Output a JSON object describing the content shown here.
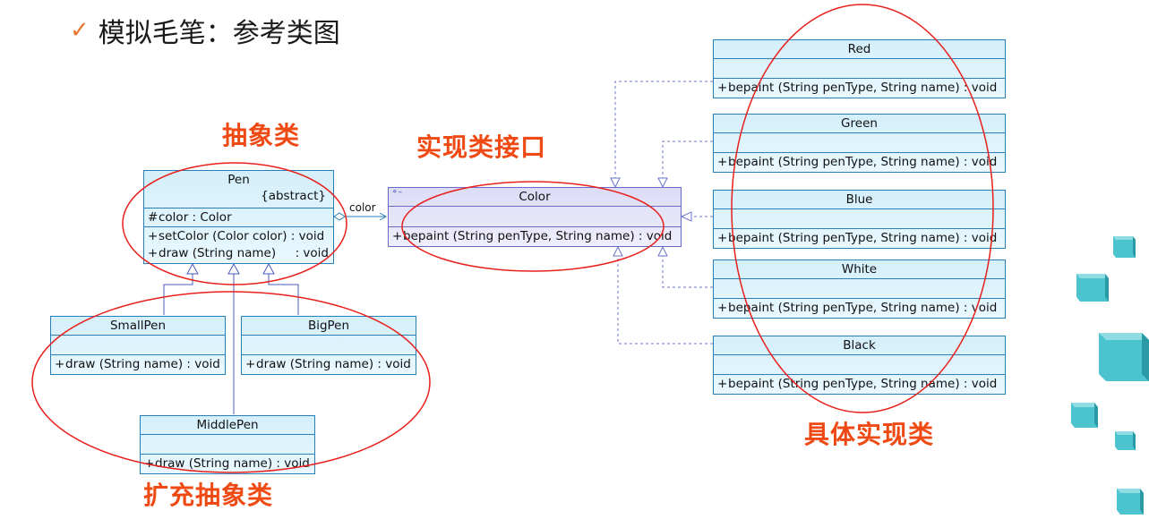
{
  "title": {
    "check_icon": "✓",
    "text": "模拟毛笔：参考类图"
  },
  "labels": {
    "abstract": "抽象类",
    "impl_interface": "实现类接口",
    "refined_abstract": "扩充抽象类",
    "concrete_impl": "具体实现类"
  },
  "association_label": "color",
  "pen": {
    "name": "Pen",
    "stereotype": "{abstract}",
    "attr_vis": "#",
    "attr": "color  : Color",
    "op1_vis": "+",
    "op1": "setColor (Color color) : void",
    "op2_vis": "+",
    "op2": "draw (String name)     : void"
  },
  "small_pen": {
    "name": "SmallPen",
    "op_vis": "+",
    "op": "draw (String name) : void"
  },
  "big_pen": {
    "name": "BigPen",
    "op_vis": "+",
    "op": "draw (String name) : void"
  },
  "middle_pen": {
    "name": "MiddlePen",
    "op_vis": "+",
    "op": "draw (String name) : void"
  },
  "color": {
    "name": "Color",
    "op_vis": "+",
    "op": "bepaint (String penType, String name) : void"
  },
  "red": {
    "name": "Red",
    "op_vis": "+",
    "op": "bepaint (String penType, String name)  : void"
  },
  "green": {
    "name": "Green",
    "op_vis": "+",
    "op": "bepaint (String penType, String name)  : void"
  },
  "blue": {
    "name": "Blue",
    "op_vis": "+",
    "op": "bepaint (String penType, String name)  : void"
  },
  "white": {
    "name": "White",
    "op_vis": "+",
    "op": "bepaint (String penType, String name)  : void"
  },
  "black": {
    "name": "Black",
    "op_vis": "+",
    "op": "bepaint (String penType, String name)  : void"
  },
  "colors": {
    "accent_red": "#f04a14",
    "ellipse_red": "#e8201c",
    "uml_blue": "#2a7fb8",
    "interface_purple": "#6a6ac8",
    "cube_teal": "#4bc4cf"
  }
}
